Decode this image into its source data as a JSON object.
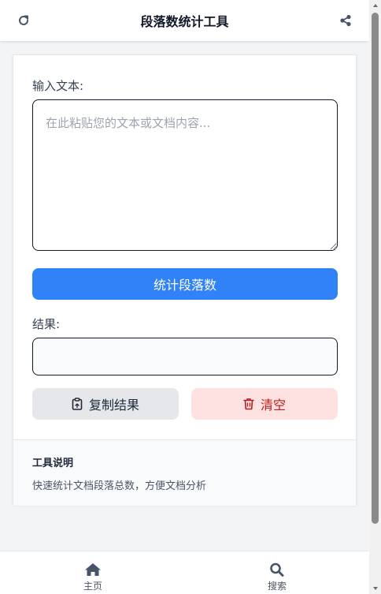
{
  "header": {
    "title": "段落数统计工具",
    "refresh_icon": "refresh-icon",
    "share_icon": "share-icon"
  },
  "form": {
    "input_label": "输入文本:",
    "input_value": "",
    "input_placeholder": "在此粘贴您的文本或文档内容...",
    "count_button": "统计段落数",
    "result_label": "结果:",
    "result_value": "",
    "copy_button": "复制结果",
    "copy_icon": "clipboard-icon",
    "clear_button": "清空",
    "clear_icon": "trash-icon"
  },
  "info": {
    "title": "工具说明",
    "description": "快速统计文档段落总数，方便文档分析"
  },
  "bottom_nav": {
    "items": [
      {
        "label": "主页",
        "icon": "home-icon"
      },
      {
        "label": "搜索",
        "icon": "search-icon"
      }
    ]
  },
  "colors": {
    "primary": "#3182f6",
    "danger_bg": "#fee2e2",
    "danger_text": "#b91c1c",
    "nav_icon": "#475569"
  }
}
